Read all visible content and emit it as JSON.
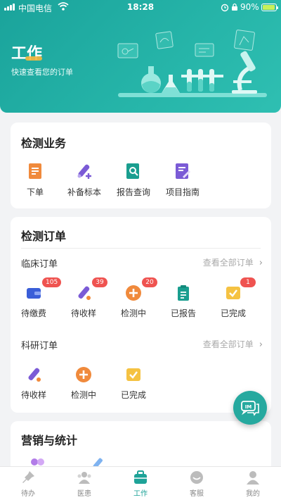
{
  "status_bar": {
    "carrier": "中国电信",
    "time": "18:28",
    "battery": "90%"
  },
  "header": {
    "title": "工作",
    "subtitle": "快速查看您的订单"
  },
  "services": {
    "title": "检测业务",
    "items": [
      {
        "label": "下单",
        "icon": "order-form-icon"
      },
      {
        "label": "补备标本",
        "icon": "test-tube-add-icon"
      },
      {
        "label": "报告查询",
        "icon": "report-search-icon"
      },
      {
        "label": "项目指南",
        "icon": "guide-book-icon"
      }
    ]
  },
  "orders": {
    "title": "检测订单",
    "clinical": {
      "label": "临床订单",
      "view_all": "查看全部订单",
      "items": [
        {
          "label": "待缴费",
          "badge": "105",
          "icon": "wallet-icon"
        },
        {
          "label": "待收样",
          "badge": "39",
          "icon": "test-tube-icon"
        },
        {
          "label": "检测中",
          "badge": "20",
          "icon": "plus-circle-icon"
        },
        {
          "label": "已报告",
          "badge": "",
          "icon": "clipboard-icon"
        },
        {
          "label": "已完成",
          "badge": "1",
          "icon": "check-box-icon"
        }
      ]
    },
    "research": {
      "label": "科研订单",
      "view_all": "查看全部订单",
      "items": [
        {
          "label": "待收样",
          "icon": "test-tube-icon"
        },
        {
          "label": "检测中",
          "icon": "plus-circle-icon"
        },
        {
          "label": "已完成",
          "icon": "check-box-icon"
        }
      ]
    }
  },
  "marketing": {
    "title": "营销与统计"
  },
  "fab": {
    "label": "IM"
  },
  "tabbar": {
    "items": [
      {
        "label": "待办",
        "icon": "pin-icon"
      },
      {
        "label": "医患",
        "icon": "users-icon"
      },
      {
        "label": "工作",
        "icon": "briefcase-icon"
      },
      {
        "label": "客服",
        "icon": "headset-icon"
      },
      {
        "label": "我的",
        "icon": "person-icon"
      }
    ]
  },
  "colors": {
    "primary": "#1ea398",
    "badge": "#ef5350",
    "orange": "#f08a3c",
    "purple": "#7b5bd6",
    "teal": "#1a9e8f",
    "yellow": "#f5c242",
    "blue": "#3a5ed8"
  }
}
